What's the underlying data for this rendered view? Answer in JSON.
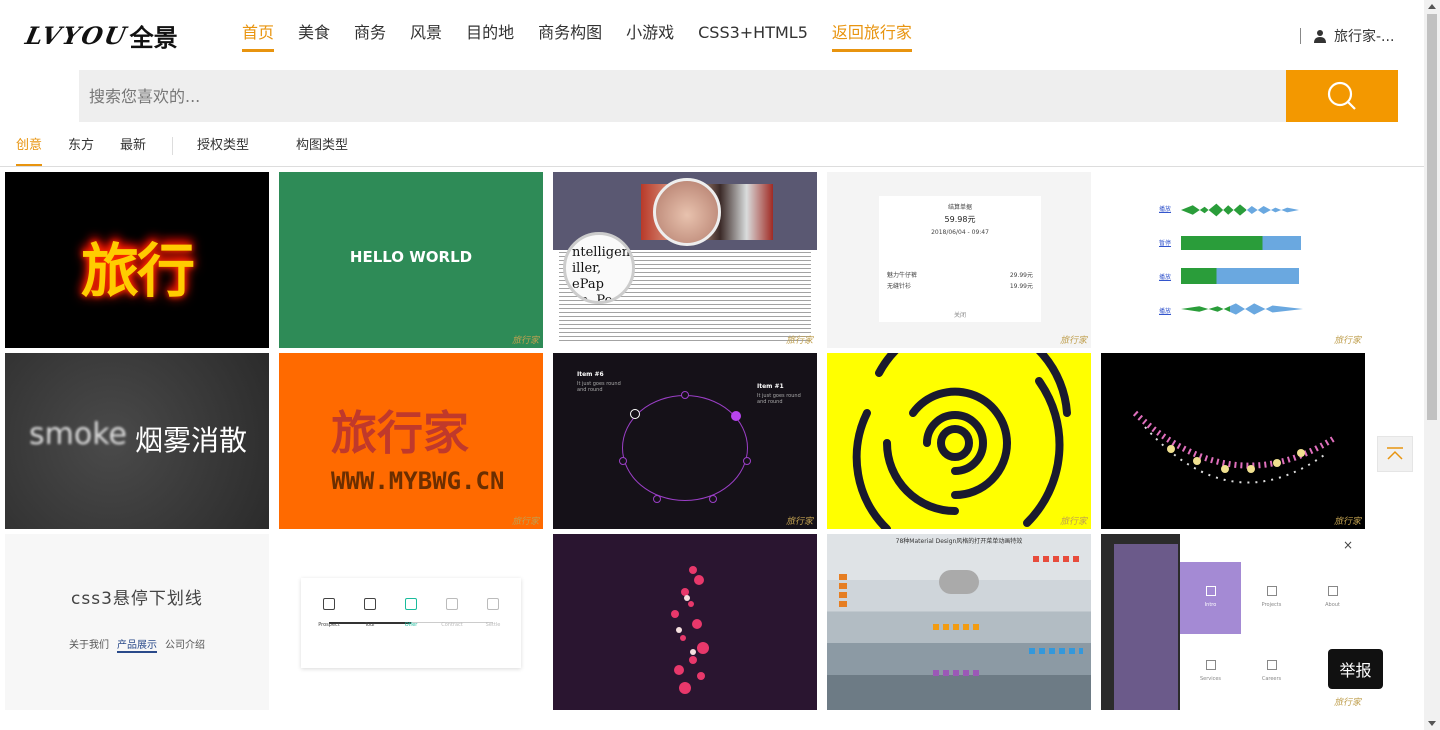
{
  "header": {
    "logo_latin": "LVYOU",
    "logo_cn": "全景",
    "nav": [
      {
        "label": "首页",
        "active": true
      },
      {
        "label": "美食",
        "active": false
      },
      {
        "label": "商务",
        "active": false
      },
      {
        "label": "风景",
        "active": false
      },
      {
        "label": "目的地",
        "active": false
      },
      {
        "label": "商务构图",
        "active": false
      },
      {
        "label": "小游戏",
        "active": false
      },
      {
        "label": "CSS3+HTML5",
        "active": false
      },
      {
        "label": "返回旅行家",
        "active": true
      }
    ],
    "user": "旅行家-..."
  },
  "search": {
    "placeholder": "搜索您喜欢的..."
  },
  "filters": {
    "tabs": [
      "创意",
      "东方",
      "最新"
    ],
    "dropdowns": [
      "授权类型",
      "构图类型"
    ]
  },
  "cards": {
    "c1": {
      "text": "旅行"
    },
    "c2": {
      "text": "HELLO WORLD"
    },
    "c4": {
      "title": "结算单据",
      "amount": "59.98元",
      "date": "2018/06/04 - 09:47",
      "row1_label": "魅力牛仔裤",
      "row1_value": "29.99元",
      "row2_label": "无缝针衫",
      "row2_value": "19.99元",
      "footer": "关闭"
    },
    "c5": {
      "labels": [
        "播放",
        "暂停",
        "播放",
        "播放"
      ]
    },
    "c6": {
      "text_latin": "smoke",
      "text_cn": "烟雾消散"
    },
    "c7": {
      "text_cn": "旅行家",
      "text_url": "WWW.MYBWG.CN"
    },
    "c8": {
      "item_left": "Item #6",
      "item_right": "Item #1",
      "sub_left": "It just goes round and round",
      "sub_right": "It just goes round and round"
    },
    "c11": {
      "title": "css3悬停下划线",
      "links": [
        "关于我们",
        "产品展示",
        "公司介绍"
      ]
    },
    "c12": {
      "steps": [
        "Prospect",
        "Tour",
        "Offer",
        "Contract",
        "Settle"
      ]
    },
    "c14": {
      "title": "78种Material Design风格的打开菜单动画特效"
    },
    "c15": {
      "items": [
        "Intro",
        "Projects",
        "About",
        "Services",
        "Careers"
      ]
    }
  },
  "watermark": "旅行家",
  "report_button": "举报",
  "colors": {
    "accent": "#f39800",
    "nav_active": "#e8940f"
  }
}
